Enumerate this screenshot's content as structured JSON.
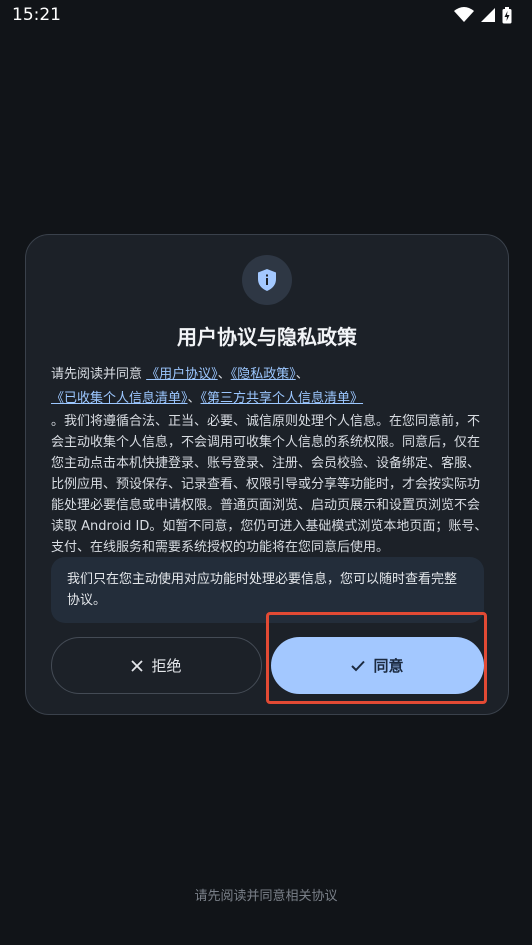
{
  "status_bar": {
    "time": "15:21",
    "icons": [
      "wifi-icon",
      "signal-icon",
      "battery-charging-icon"
    ]
  },
  "dialog": {
    "icon": "shield-info-icon",
    "title": "用户协议与隐私政策",
    "intro_prefix": "请先阅读并同意",
    "links": [
      "《用户协议》",
      "《隐私政策》",
      "《已收集个人信息清单》",
      "《第三方共享个人信息清单》"
    ],
    "separator": "、",
    "body": "。我们将遵循合法、正当、必要、诚信原则处理个人信息。在您同意前，不会主动收集个人信息，不会调用可收集个人信息的系统权限。同意后，仅在您主动点击本机快捷登录、账号登录、注册、会员校验、设备绑定、客服、比例应用、预设保存、记录查看、权限引导或分享等功能时，才会按实际功能处理必要信息或申请权限。普通页面浏览、启动页展示和设置页浏览不会读取 Android ID。如暂不同意，您仍可进入基础模式浏览本地页面；账号、支付、在线服务和需要系统授权的功能将在您同意后使用。",
    "note": "我们只在您主动使用对应功能时处理必要信息，您可以随时查看完整协议。",
    "reject_label": "拒绝",
    "agree_label": "同意"
  },
  "footer": "请先阅读并同意相关协议",
  "colors": {
    "background": "#111418",
    "dialog": "#1c2128",
    "link": "#9cc7ff",
    "agree_button": "#a3c8ff",
    "highlight": "#e24a34"
  }
}
